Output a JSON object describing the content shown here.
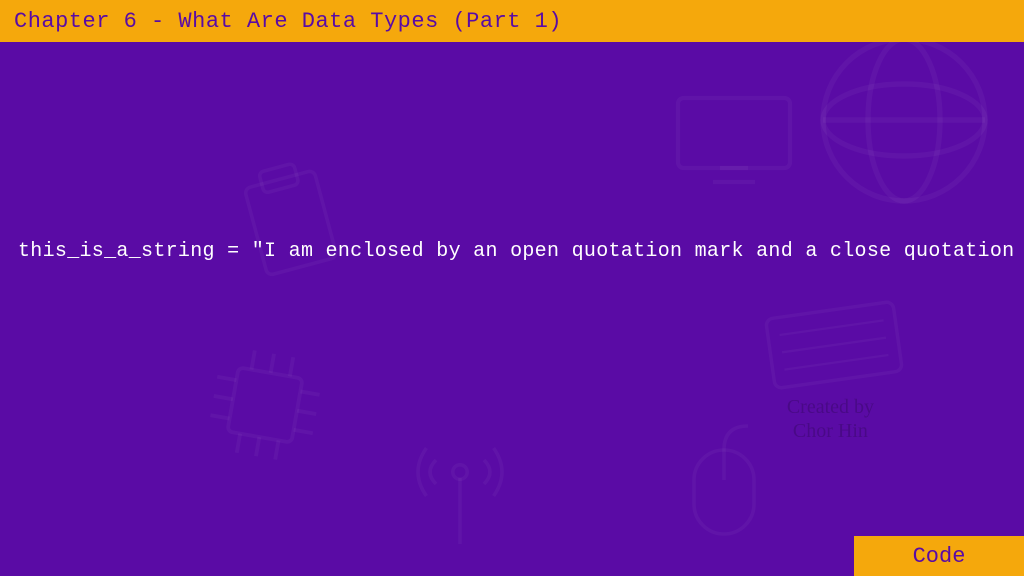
{
  "header": {
    "title": "Chapter 6 - What Are Data Types (Part 1)"
  },
  "code": {
    "line1": "this_is_a_string = \"I am enclosed by an open quotation mark and a close quotation mark\""
  },
  "footer": {
    "label": "Code"
  },
  "credit": {
    "line1": "Created by",
    "line2": "Chor Hin"
  },
  "colors": {
    "background": "#5a0ba5",
    "accent": "#f5a80c",
    "text_on_accent": "#5a0ba5",
    "code_text": "#ffffff"
  }
}
